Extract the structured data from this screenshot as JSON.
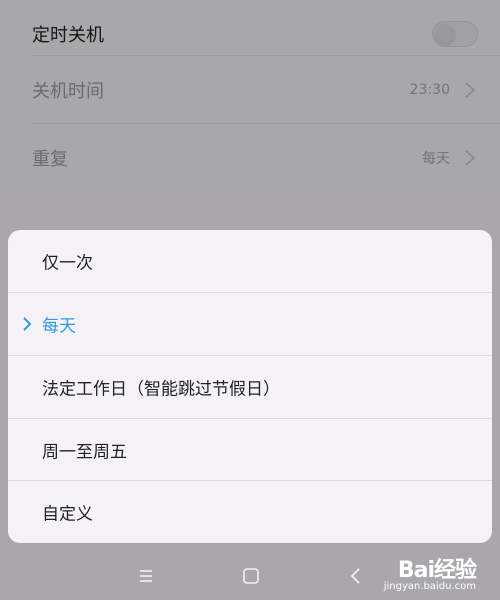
{
  "settings": {
    "rows": [
      {
        "label": "定时关机",
        "value": "",
        "type": "toggle",
        "toggle_on": false
      },
      {
        "label": "关机时间",
        "value": "23:30",
        "type": "chevron"
      },
      {
        "label": "重复",
        "value": "每天",
        "type": "chevron"
      }
    ]
  },
  "repeat_sheet": {
    "options": [
      {
        "label": "仅一次",
        "selected": false
      },
      {
        "label": "每天",
        "selected": true
      },
      {
        "label": "法定工作日（智能跳过节假日）",
        "selected": false
      },
      {
        "label": "周一至周五",
        "selected": false
      },
      {
        "label": "自定义",
        "selected": false
      }
    ],
    "selected_color": "#2c9be0"
  },
  "navbar": {
    "buttons": [
      "menu-icon",
      "home-icon",
      "back-icon"
    ]
  },
  "watermark": {
    "brand": "Bai经验",
    "url": "jingyan.baidu.com"
  }
}
